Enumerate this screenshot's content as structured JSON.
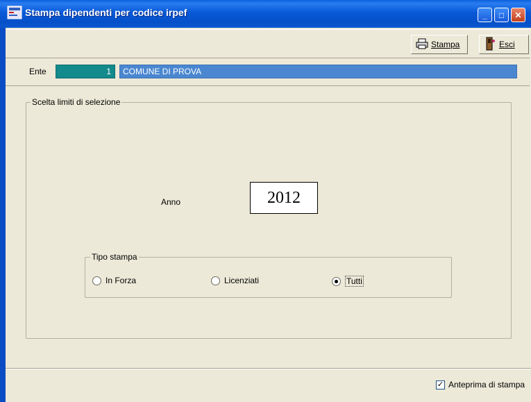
{
  "window": {
    "title": "Stampa dipendenti per codice irpef",
    "minimize_glyph": "_",
    "maximize_glyph": "□",
    "close_glyph": "✕"
  },
  "toolbar": {
    "stampa_label": "Stampa",
    "esci_label": "Esci",
    "stampa_icon": "printer-icon",
    "esci_icon": "exit-door-icon"
  },
  "ente": {
    "label": "Ente",
    "code": "1",
    "name": "COMUNE DI PROVA"
  },
  "selection": {
    "group_title": "Scelta limiti di selezione",
    "anno_label": "Anno",
    "anno_value": "2012",
    "tipo_group_title": "Tipo stampa",
    "options": [
      {
        "label": "In Forza",
        "selected": false
      },
      {
        "label": "Licenziati",
        "selected": false
      },
      {
        "label": "Tutti",
        "selected": true
      }
    ]
  },
  "footer": {
    "anteprima_label": "Anteprima di stampa",
    "anteprima_checked": true,
    "check_glyph": "✓"
  },
  "colors": {
    "titlebar": "#0859d8",
    "ente_code_bg": "#138a8c",
    "ente_name_bg": "#4a87d0",
    "window_bg": "#ece9d8"
  }
}
